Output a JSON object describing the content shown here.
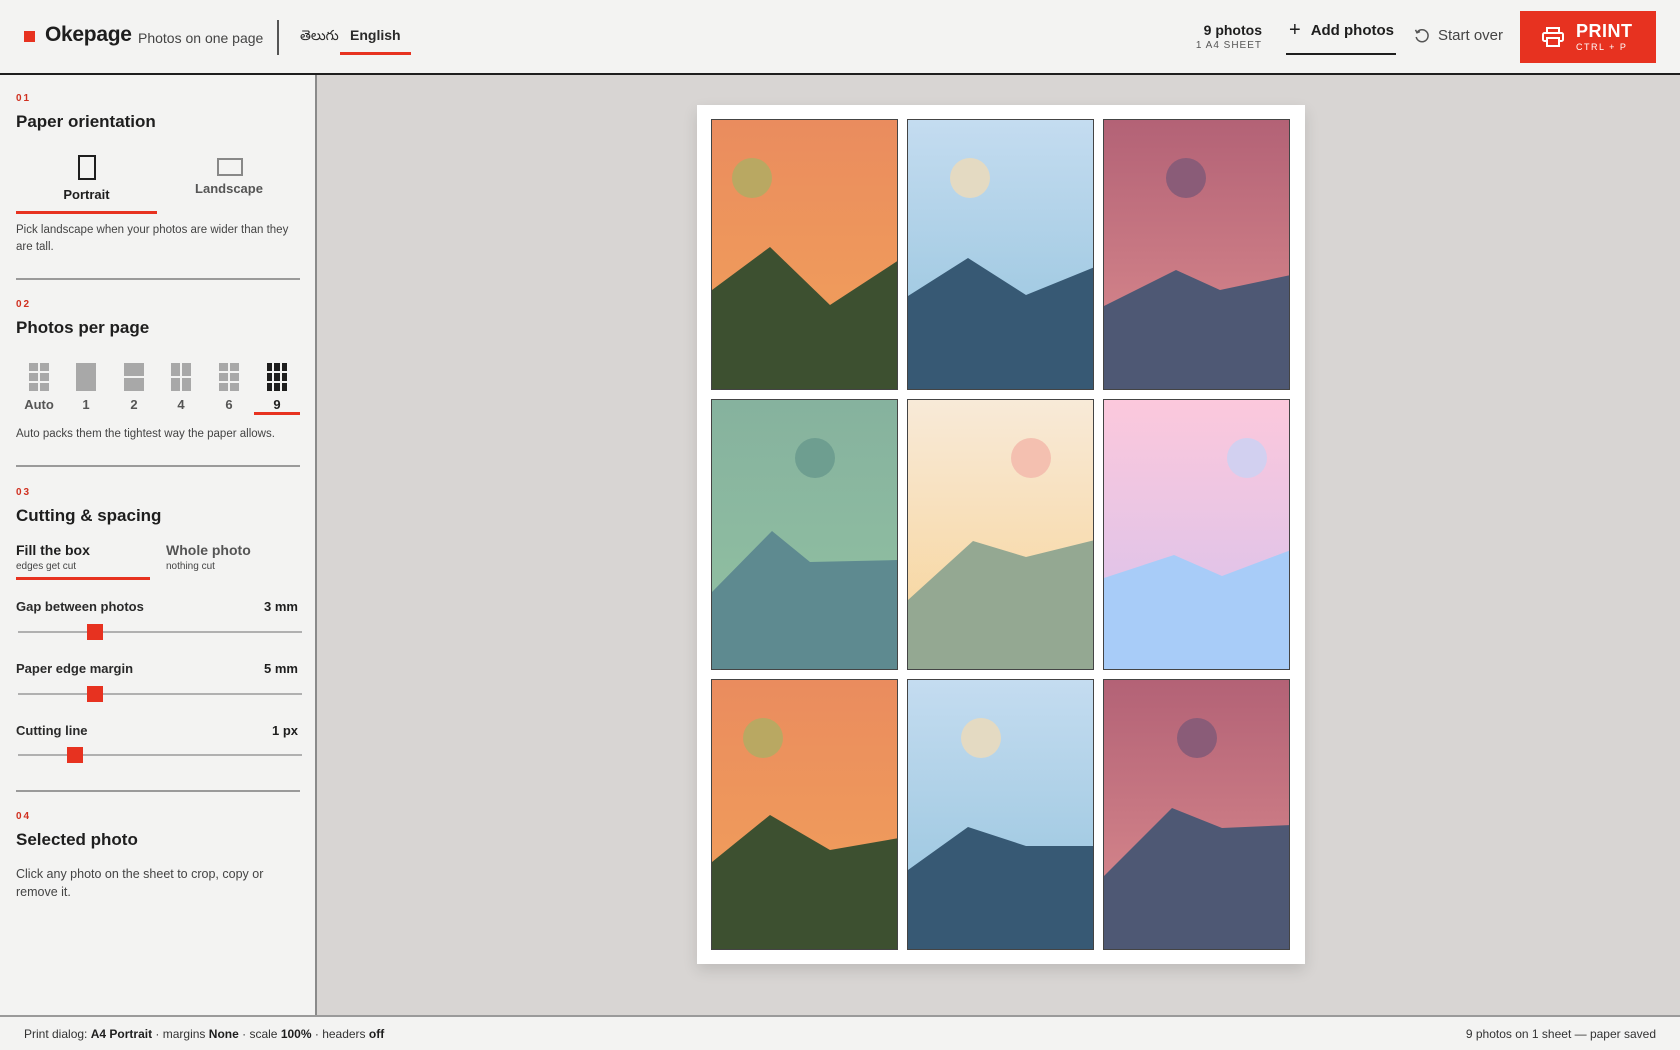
{
  "app": {
    "name": "Okepage",
    "tagline": "Photos on one page",
    "accent": "#e73220"
  },
  "languages": [
    {
      "label": "తెలుగు",
      "active": false
    },
    {
      "label": "English",
      "active": true
    }
  ],
  "header": {
    "photo_count": "9 photos",
    "sheet_count": "1 A4 SHEET",
    "add_photos": "Add photos",
    "start_over": "Start over",
    "print_label": "PRINT",
    "print_shortcut": "CTRL + P",
    "icons": {
      "add": "plus-icon",
      "start_over": "refresh-icon",
      "print": "printer-icon"
    }
  },
  "sidebar": {
    "orientation": {
      "num": "01",
      "title": "Paper orientation",
      "options": [
        {
          "label": "Portrait",
          "selected": true,
          "icon": "portrait-icon"
        },
        {
          "label": "Landscape",
          "selected": false,
          "icon": "landscape-icon"
        }
      ],
      "hint": "Pick landscape when your photos are wider than they are tall."
    },
    "per_page": {
      "num": "02",
      "title": "Photos per page",
      "options": [
        {
          "label": "Auto",
          "selected": false
        },
        {
          "label": "1",
          "selected": false
        },
        {
          "label": "2",
          "selected": false
        },
        {
          "label": "4",
          "selected": false
        },
        {
          "label": "6",
          "selected": false
        },
        {
          "label": "9",
          "selected": true
        }
      ],
      "hint": "Auto packs them the tightest way the paper allows."
    },
    "cutting": {
      "num": "03",
      "title": "Cutting & spacing",
      "modes": [
        {
          "label": "Fill the box",
          "sub": "edges get cut",
          "selected": true
        },
        {
          "label": "Whole photo",
          "sub": "nothing cut",
          "selected": false
        }
      ],
      "sliders": [
        {
          "label": "Gap between photos",
          "value": "3 mm",
          "level": 0.27
        },
        {
          "label": "Paper edge margin",
          "value": "5 mm",
          "level": 0.27
        },
        {
          "label": "Cutting line",
          "value": "1 px",
          "level": 0.2
        }
      ]
    },
    "selected": {
      "num": "04",
      "title": "Selected photo",
      "hint": "Click any photo on the sheet to crop, copy or remove it."
    }
  },
  "sheet": {
    "photos": [
      {
        "sky": [
          "#ea8c5e",
          "#f2a25a"
        ],
        "sun": "#b9a862",
        "mountain": "#3d5030"
      },
      {
        "sky": [
          "#c4dcf0",
          "#92c2dc"
        ],
        "sun": "#e4dac2",
        "mountain": "#375974"
      },
      {
        "sky": [
          "#b36276",
          "#dd8e90"
        ],
        "sun": "#8a5c78",
        "mountain": "#4e5874"
      },
      {
        "sky": [
          "#86b29e",
          "#92c2a2"
        ],
        "sun": "#6e9e90",
        "mountain": "#5e8a90"
      },
      {
        "sky": [
          "#f8ead8",
          "#f7d294"
        ],
        "sun": "#f4c0b0",
        "mountain": "#94a892"
      },
      {
        "sky": [
          "#fcc8dc",
          "#d4c2ee"
        ],
        "sun": "#d2d0f0",
        "mountain": "#a8ccf8"
      },
      {
        "sky": [
          "#ea8c5e",
          "#f2a25a"
        ],
        "sun": "#b9a862",
        "mountain": "#3d5030"
      },
      {
        "sky": [
          "#c4dcf0",
          "#92c2dc"
        ],
        "sun": "#e4dac2",
        "mountain": "#375974"
      },
      {
        "sky": [
          "#b36276",
          "#dd8e90"
        ],
        "sun": "#8a5c78",
        "mountain": "#4e5874"
      }
    ]
  },
  "footer": {
    "dialog_label": "Print dialog:",
    "paper": "A4 Portrait",
    "margins_label": "· margins",
    "margins": "None",
    "scale_label": "· scale",
    "scale": "100%",
    "headers_label": "· headers",
    "headers": "off",
    "summary": "9 photos on 1 sheet — paper saved"
  }
}
